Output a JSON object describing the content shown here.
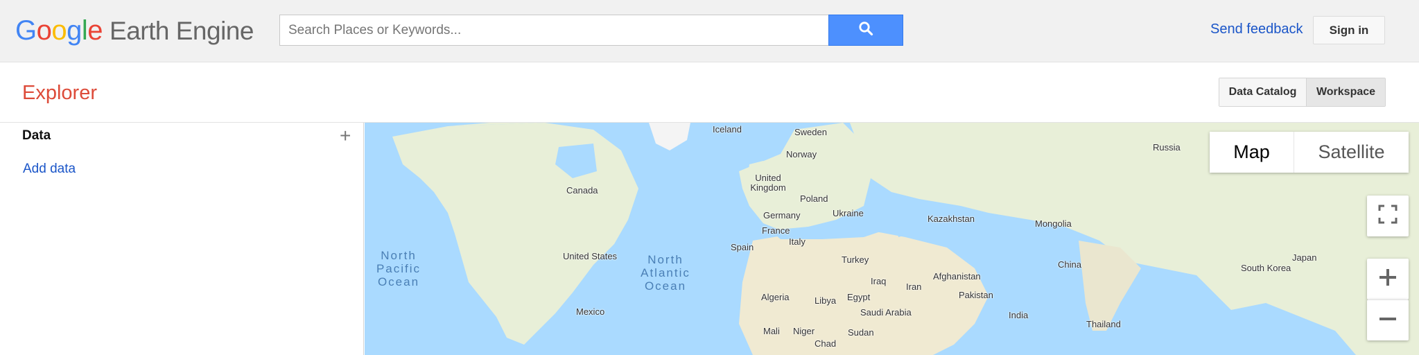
{
  "header": {
    "logo_letters": [
      "G",
      "o",
      "o",
      "g",
      "l",
      "e"
    ],
    "product_name": "Earth Engine",
    "search_placeholder": "Search Places or Keywords...",
    "send_feedback": "Send feedback",
    "sign_in": "Sign in"
  },
  "subheader": {
    "title": "Explorer",
    "tabs": [
      "Data Catalog",
      "Workspace"
    ],
    "active_tab": "Workspace"
  },
  "sidebar": {
    "heading": "Data",
    "add_icon": "+",
    "add_data_link": "Add data"
  },
  "map": {
    "type_buttons": [
      "Map",
      "Satellite"
    ],
    "selected_type": "Map",
    "countries": [
      "Iceland",
      "Sweden",
      "Norway",
      "Russia",
      "United Kingdom",
      "Poland",
      "Germany",
      "Ukraine",
      "Kazakhstan",
      "Mongolia",
      "France",
      "Italy",
      "Spain",
      "Turkey",
      "China",
      "South Korea",
      "Japan",
      "Afghanistan",
      "Iraq",
      "Iran",
      "Pakistan",
      "Algeria",
      "Libya",
      "Egypt",
      "Saudi Arabia",
      "India",
      "Thailand",
      "Mali",
      "Niger",
      "Chad",
      "Sudan",
      "Canada",
      "United States",
      "Mexico"
    ],
    "oceans": [
      "North Pacific Ocean",
      "North Atlantic Ocean"
    ],
    "controls": [
      "fullscreen-icon",
      "zoom-in-icon",
      "zoom-out-icon"
    ]
  },
  "colors": {
    "google_blue": "#4285f4",
    "google_red": "#ea4335",
    "google_yellow": "#fbbc05",
    "google_green": "#34a853",
    "explorer_red": "#dd4b39",
    "link_blue": "#1a55c8",
    "search_button": "#4d90fe",
    "water": "#aadaff",
    "land": "#e8efd8"
  }
}
